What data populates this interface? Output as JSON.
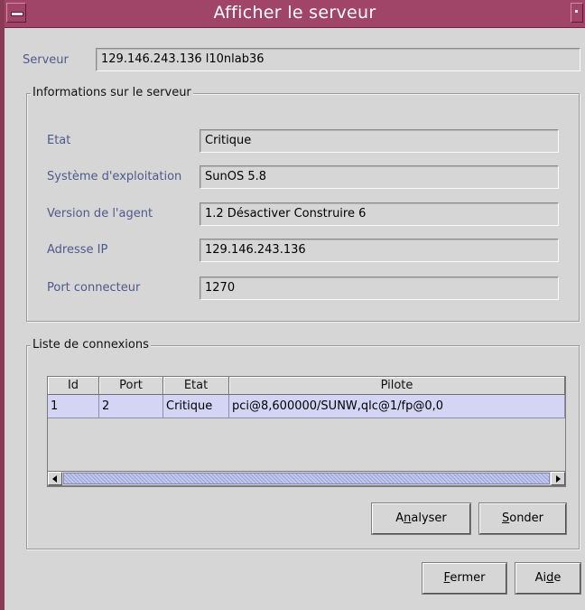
{
  "window": {
    "title": "Afficher le serveur"
  },
  "server": {
    "label": "Serveur",
    "value": "129.146.243.136 l10nlab36"
  },
  "info_group": {
    "title": "Informations sur le serveur",
    "rows": [
      {
        "label": "Etat",
        "value": "Critique"
      },
      {
        "label": "Système d'exploitation",
        "value": "SunOS 5.8"
      },
      {
        "label": "Version de l'agent",
        "value": "1.2 Désactiver Construire 6"
      },
      {
        "label": "Adresse IP",
        "value": "129.146.243.136"
      },
      {
        "label": "Port connecteur",
        "value": "1270"
      }
    ]
  },
  "connections": {
    "title": "Liste de connexions",
    "columns": [
      "Id",
      "Port",
      "Etat",
      "Pilote"
    ],
    "rows": [
      [
        "1",
        "2",
        "Critique",
        "pci@8,600000/SUNW,qlc@1/fp@0,0"
      ]
    ],
    "selected_row_color": "#d4d4f5"
  },
  "buttons": {
    "analyser": {
      "before": "A",
      "mnemonic": "n",
      "after": "alyser"
    },
    "sonder": {
      "before": "",
      "mnemonic": "S",
      "after": "onder"
    },
    "fermer": {
      "before": "",
      "mnemonic": "F",
      "after": "ermer"
    },
    "aide": {
      "before": "Ai",
      "mnemonic": "d",
      "after": "e"
    }
  },
  "colors": {
    "titlebar": "#a04568",
    "label": "#4e5a8a",
    "background": "#d6d6d6"
  }
}
